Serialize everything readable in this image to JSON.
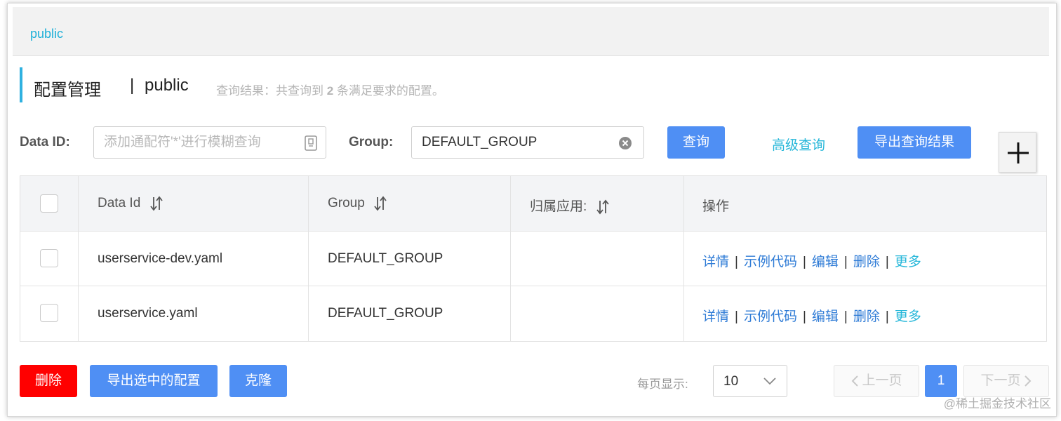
{
  "namespace_tab": {
    "label": "public"
  },
  "header": {
    "title": "配置管理",
    "separator": "|",
    "namespace": "public",
    "result_prefix": "查询结果：共查询到 ",
    "result_count": "2",
    "result_suffix": " 条满足要求的配置。"
  },
  "filters": {
    "data_id_label": "Data ID:",
    "data_id_placeholder": "添加通配符'*'进行模糊查询",
    "group_label": "Group:",
    "group_value": "DEFAULT_GROUP",
    "query_button": "查询",
    "advanced_query": "高级查询",
    "export_results_button": "导出查询结果",
    "add_symbol": "+"
  },
  "table": {
    "columns": [
      "Data Id",
      "Group",
      "归属应用:",
      "操作"
    ],
    "rows": [
      {
        "data_id": "userservice-dev.yaml",
        "group": "DEFAULT_GROUP",
        "app": ""
      },
      {
        "data_id": "userservice.yaml",
        "group": "DEFAULT_GROUP",
        "app": ""
      }
    ],
    "actions": {
      "details": "详情",
      "sample_code": "示例代码",
      "edit": "编辑",
      "delete": "删除",
      "more": "更多",
      "sep": "|"
    }
  },
  "footer": {
    "delete_button": "删除",
    "export_selected_button": "导出选中的配置",
    "clone_button": "克隆",
    "page_size_label": "每页显示:",
    "page_size_value": "10",
    "prev_page": "上一页",
    "current_page": "1",
    "next_page": "下一页"
  },
  "watermark": "@稀土掘金技术社区",
  "colors": {
    "primary": "#4f8ff4",
    "danger": "#ff0000",
    "link": "#2e7bd6",
    "accent": "#26b7d9",
    "title_bar": "#2fb1e0"
  }
}
